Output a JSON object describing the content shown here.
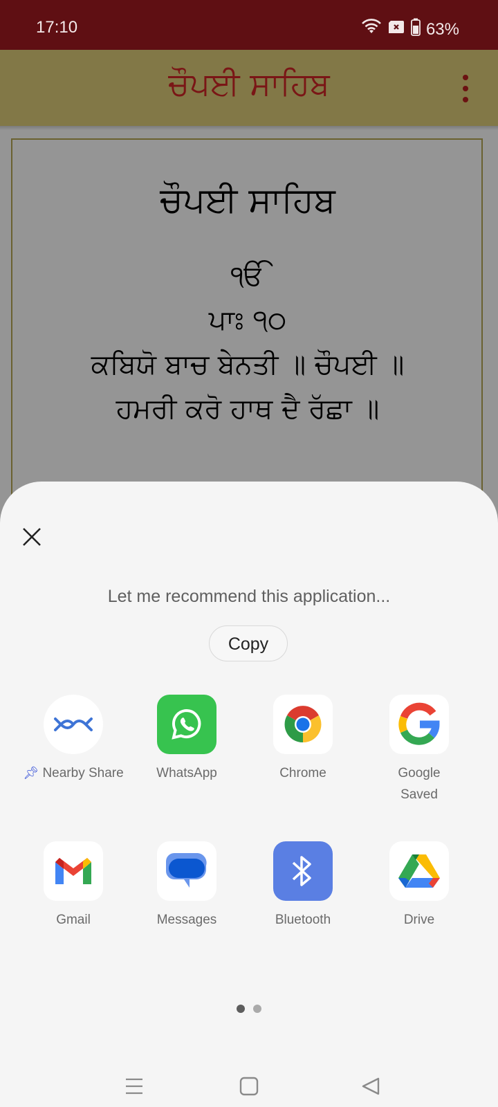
{
  "status_bar": {
    "time": "17:10",
    "battery": "63%",
    "icons": [
      "wifi-icon",
      "no-sim-icon",
      "battery-icon"
    ]
  },
  "app_bar": {
    "title": "ਚੌਪਈ ਸਾਹਿਬ",
    "menu_icon": "more-vert-icon",
    "colors": {
      "status_bar": "#5f0f13",
      "app_bar": "#827847",
      "title": "#7a1616"
    }
  },
  "content": {
    "heading": "ਚੌਪਈ ਸਾਹਿਬ",
    "lines": [
      "ੴ",
      "ਪਾਃ ੧੦",
      "ਕਬਿਯੋ ਬਾਚ ਬੇਨਤੀ ॥ ਚੌਪਈ ॥",
      "ਹਮਰੀ ਕਰੋ ਹਾਥ ਦੈ ਰੱਛਾ ॥"
    ]
  },
  "share_sheet": {
    "message": "Let me recommend this application...",
    "copy_label": "Copy",
    "close_icon": "close-icon",
    "apps": [
      {
        "label": "Nearby Share",
        "icon": "nearby-share-icon",
        "pinned": true
      },
      {
        "label": "WhatsApp",
        "icon": "whatsapp-icon"
      },
      {
        "label": "Chrome",
        "icon": "chrome-icon"
      },
      {
        "label": "Google",
        "label2": "Saved",
        "icon": "google-icon"
      },
      {
        "label": "Gmail",
        "icon": "gmail-icon"
      },
      {
        "label": "Messages",
        "icon": "messages-icon"
      },
      {
        "label": "Bluetooth",
        "icon": "bluetooth-icon"
      },
      {
        "label": "Drive",
        "icon": "drive-icon"
      }
    ],
    "page_indicator": {
      "current": 1,
      "total": 2
    }
  },
  "nav_bar": {
    "buttons": [
      "recents-menu-icon",
      "home-icon",
      "back-icon"
    ]
  }
}
